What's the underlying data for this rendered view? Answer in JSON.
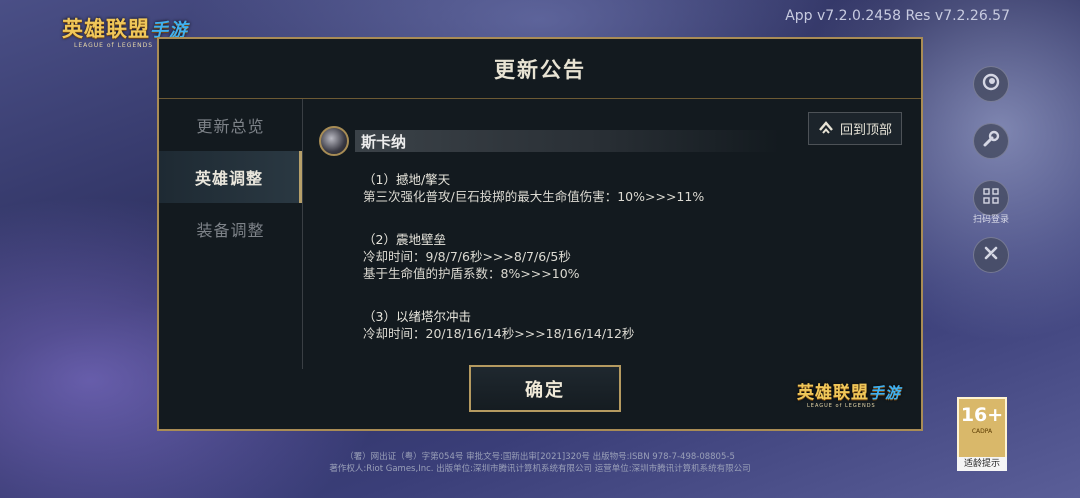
{
  "top_logo": {
    "cn": "英雄联盟",
    "script": "手游",
    "en": "LEAGUE of LEGENDS"
  },
  "version_text": "App v7.2.0.2458 Res v7.2.26.57",
  "dialog": {
    "title": "更新公告",
    "nav": [
      {
        "label": "更新总览"
      },
      {
        "label": "英雄调整",
        "active": true
      },
      {
        "label": "装备调整"
      }
    ],
    "back_to_top": "回到顶部",
    "champion": "斯卡纳",
    "changes": [
      {
        "skill": "（1）撼地/擎天",
        "lines": [
          "第三次强化普攻/巨石投掷的最大生命值伤害：10%>>>11%"
        ]
      },
      {
        "skill": "（2）震地壁垒",
        "lines": [
          "冷却时间：9/8/7/6秒>>>8/7/6/5秒",
          "基于生命值的护盾系数：8%>>>10%"
        ]
      },
      {
        "skill": "（3）以绪塔尔冲击",
        "lines": [
          "冷却时间：20/18/16/14秒>>>18/16/14/12秒"
        ]
      }
    ],
    "confirm": "确定",
    "logo": {
      "cn": "英雄联盟",
      "script": "手游",
      "en": "LEAGUE of LEGENDS"
    }
  },
  "side_buttons": {
    "scan_label": "扫码登录"
  },
  "age_rating": {
    "age": "16+",
    "org": "CADPA",
    "tip": "适龄提示"
  },
  "footer": {
    "line1": "（署）网出证（粤）字第054号  审批文号:国新出审[2021]320号  出版物号:ISBN 978-7-498-08805-5",
    "line2": "著作权人:Riot Games,Inc.  出版单位:深圳市腾讯计算机系统有限公司  运营单位:深圳市腾讯计算机系统有限公司"
  },
  "colors": {
    "gold": "#a98c55",
    "panel": "#131a1f",
    "text": "#dcdad2"
  }
}
